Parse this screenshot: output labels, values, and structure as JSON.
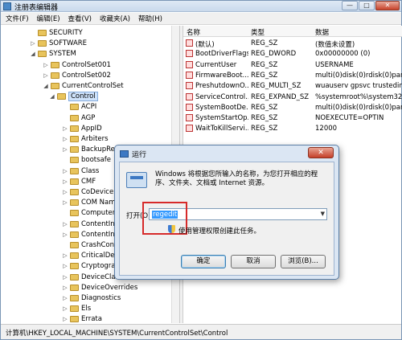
{
  "window": {
    "title": "注册表编辑器",
    "buttons": [
      "—",
      "□",
      "✕"
    ]
  },
  "menu": [
    "文件(F)",
    "编辑(E)",
    "查看(V)",
    "收藏夹(A)",
    "帮助(H)"
  ],
  "tree": [
    {
      "label": "SECURITY",
      "arrow": ""
    },
    {
      "label": "SOFTWARE",
      "arrow": "▷"
    },
    {
      "label": "SYSTEM",
      "arrow": "◢"
    },
    {
      "label": "ControlSet001",
      "arrow": "▷"
    },
    {
      "label": "ControlSet002",
      "arrow": "▷"
    },
    {
      "label": "CurrentControlSet",
      "arrow": "◢"
    },
    {
      "label": "Control",
      "arrow": "◢"
    },
    {
      "label": "ACPI",
      "arrow": ""
    },
    {
      "label": "AGP",
      "arrow": ""
    },
    {
      "label": "AppID",
      "arrow": "▷"
    },
    {
      "label": "Arbiters",
      "arrow": "▷"
    },
    {
      "label": "BackupRes",
      "arrow": "▷"
    },
    {
      "label": "bootsafe",
      "arrow": ""
    },
    {
      "label": "Class",
      "arrow": "▷"
    },
    {
      "label": "CMF",
      "arrow": "▷"
    },
    {
      "label": "CoDeviceIn",
      "arrow": "▷"
    },
    {
      "label": "COM Nam",
      "arrow": "▷"
    },
    {
      "label": "Computer",
      "arrow": ""
    },
    {
      "label": "ContentInd",
      "arrow": "▷"
    },
    {
      "label": "ContentInd",
      "arrow": "▷"
    },
    {
      "label": "CrashContr",
      "arrow": ""
    },
    {
      "label": "CriticalDev",
      "arrow": "▷"
    },
    {
      "label": "Cryptograp",
      "arrow": "▷"
    },
    {
      "label": "DeviceClas",
      "arrow": "▷"
    },
    {
      "label": "DeviceOverrides",
      "arrow": "▷"
    },
    {
      "label": "Diagnostics",
      "arrow": "▷"
    },
    {
      "label": "Els",
      "arrow": "▷"
    },
    {
      "label": "Errata",
      "arrow": "▷"
    }
  ],
  "list": {
    "headers": [
      "名称",
      "类型",
      "数据"
    ],
    "rows": [
      [
        "(默认)",
        "REG_SZ",
        "(数值未设置)"
      ],
      [
        "BootDriverFlags",
        "REG_DWORD",
        "0x00000000 (0)"
      ],
      [
        "CurrentUser",
        "REG_SZ",
        "USERNAME"
      ],
      [
        "FirmwareBoot...",
        "REG_SZ",
        "multi(0)disk(0)rdisk(0)parti"
      ],
      [
        "PreshutdownO...",
        "REG_MULTI_SZ",
        "wuauserv gpsvc trustedins"
      ],
      [
        "ServiceControl...",
        "REG_EXPAND_SZ",
        "%systemroot%\\system32\\"
      ],
      [
        "SystemBootDe...",
        "REG_SZ",
        "multi(0)disk(0)rdisk(0)parti"
      ],
      [
        "SystemStartOp...",
        "REG_SZ",
        " NOEXECUTE=OPTIN"
      ],
      [
        "WaitToKillServi...",
        "REG_SZ",
        "12000"
      ]
    ]
  },
  "status": "计算机\\HKEY_LOCAL_MACHINE\\SYSTEM\\CurrentControlSet\\Control",
  "run": {
    "title": "运行",
    "close": "✕",
    "desc": "Windows 将根据您所输入的名称，为您打开相应的程序、文件夹、文档或 Internet 资源。",
    "open_label": "打开(O):",
    "open_value": "regedit",
    "admin_text": "使用管理权限创建此任务。",
    "ok": "确定",
    "cancel": "取消",
    "browse": "浏览(B)..."
  },
  "colors": {
    "highlight": "#3399ff",
    "callout": "#d62a2a"
  }
}
